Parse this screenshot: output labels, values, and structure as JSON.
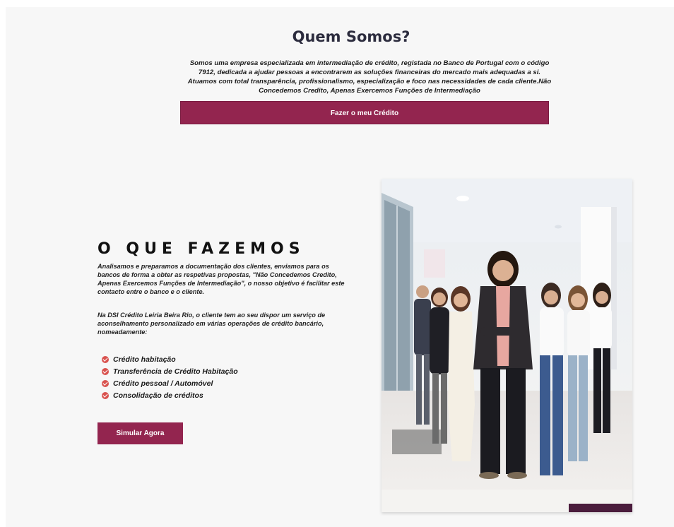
{
  "about": {
    "title": "Quem Somos?",
    "text": "Somos uma empresa especializada em intermediação de crédito, registada no Banco de Portugal com o código 7912, dedicada a ajudar pessoas a encontrarem as soluções financeiras do mercado mais adequadas a si. Atuamos com total transparência, profissionalismo, especialização e foco nas necessidades de cada cliente.Não Concedemos Credito, Apenas Exercemos Funções de Intermediação",
    "cta_label": "Fazer o meu Crédito"
  },
  "services": {
    "title": "O QUE FAZEMOS",
    "paragraph1": "Analisamos e preparamos a documentação dos clientes, enviamos para os bancos de forma a obter as respetivas propostas, \"Não Concedemos Credito, Apenas Exercemos Funções de Intermediação\", o nosso objetivo é facilitar este contacto entre o banco e o cliente.",
    "paragraph2": "Na DSI Crédito Leiria Beira Rio, o cliente tem ao seu dispor um serviço de aconselhamento personalizado em várias operações de crédito bancário, nomeadamente:",
    "items": [
      {
        "label": "Crédito habitação"
      },
      {
        "label": "Transferência de Crédito Habitação"
      },
      {
        "label": "Crédito pessoal / Automóvel"
      },
      {
        "label": "Consolidação de créditos"
      }
    ],
    "cta_label": "Simular Agora"
  },
  "colors": {
    "accent": "#93254f",
    "check": "#d9534f",
    "background": "#f7f7f7"
  },
  "icons": {
    "list_marker": "check-circle-icon"
  }
}
